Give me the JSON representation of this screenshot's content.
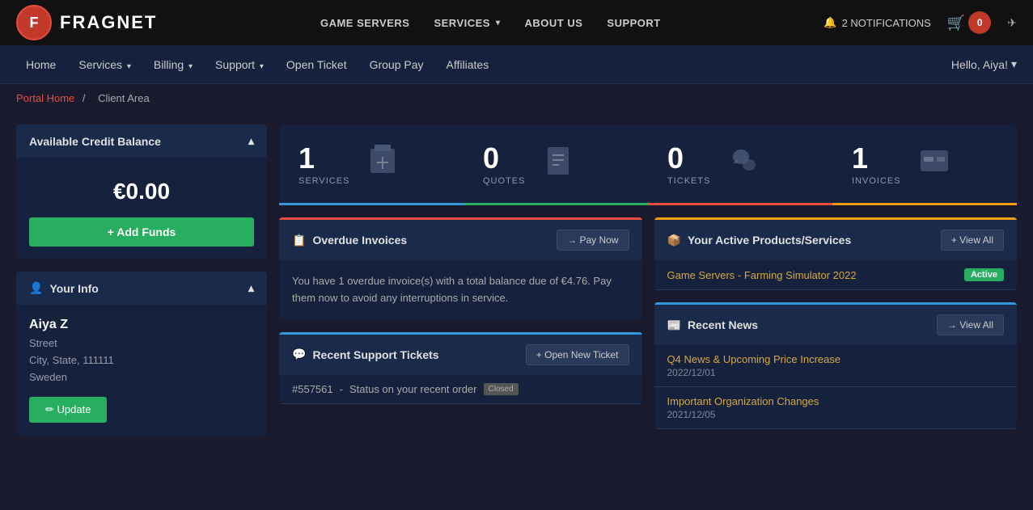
{
  "topNav": {
    "logo_text": "FRAGNET",
    "logo_short": "F",
    "links": [
      {
        "label": "GAME SERVERS",
        "id": "game-servers"
      },
      {
        "label": "SERVICES",
        "id": "services",
        "has_dropdown": true
      },
      {
        "label": "ABOUT US",
        "id": "about-us"
      },
      {
        "label": "SUPPORT",
        "id": "support"
      }
    ],
    "notifications_label": "2 NOTIFICATIONS",
    "cart_count": "0",
    "arrow_icon": "✈"
  },
  "secondNav": {
    "links": [
      {
        "label": "Home",
        "id": "home"
      },
      {
        "label": "Services",
        "id": "services",
        "has_dropdown": true
      },
      {
        "label": "Billing",
        "id": "billing",
        "has_dropdown": true
      },
      {
        "label": "Support",
        "id": "support",
        "has_dropdown": true
      },
      {
        "label": "Open Ticket",
        "id": "open-ticket"
      },
      {
        "label": "Group Pay",
        "id": "group-pay"
      },
      {
        "label": "Affiliates",
        "id": "affiliates"
      }
    ],
    "hello_user": "Hello, Aiya!"
  },
  "breadcrumb": {
    "portal_home": "Portal Home",
    "separator": "/",
    "current": "Client Area"
  },
  "sidebar": {
    "credit_header": "Available Credit Balance",
    "credit_amount": "€0.00",
    "add_funds_label": "+ Add Funds",
    "your_info_header": "Your Info",
    "user_name": "Aiya Z",
    "street": "Street",
    "city_state": "City, State, 111111",
    "country": "Sweden",
    "update_label": "✏ Update"
  },
  "stats": [
    {
      "number": "1",
      "label": "SERVICES",
      "type": "services"
    },
    {
      "number": "0",
      "label": "QUOTES",
      "type": "quotes"
    },
    {
      "number": "0",
      "label": "TICKETS",
      "type": "tickets"
    },
    {
      "number": "1",
      "label": "INVOICES",
      "type": "invoices"
    }
  ],
  "overdueInvoices": {
    "header": "Overdue Invoices",
    "pay_now_label": "→ Pay Now",
    "message": "You have 1 overdue invoice(s) with a total balance due of €4.76. Pay them now to avoid any interruptions in service."
  },
  "recentTickets": {
    "header": "Recent Support Tickets",
    "open_new_label": "+ Open New Ticket",
    "ticket": {
      "id": "#557561",
      "subject": "Status on your recent order",
      "status": "Closed"
    }
  },
  "activeProducts": {
    "header": "Your Active Products/Services",
    "view_all_label": "+ View All",
    "product": {
      "name": "Game Servers - Farming Simulator 2022",
      "status": "Active"
    }
  },
  "recentNews": {
    "header": "Recent News",
    "view_all_label": "→ View All",
    "items": [
      {
        "title": "Q4 News & Upcoming Price Increase",
        "date": "2022/12/01"
      },
      {
        "title": "Important Organization Changes",
        "date": "2021/12/05"
      }
    ]
  },
  "icons": {
    "box": "📦",
    "document": "📄",
    "chat": "💬",
    "card": "💳",
    "bell": "🔔",
    "cart": "🛒",
    "chevron_down": "▾",
    "chevron_up": "▴",
    "user": "👤",
    "invoice": "📋",
    "ticket": "🎫",
    "news": "📰",
    "pencil": "✏"
  }
}
